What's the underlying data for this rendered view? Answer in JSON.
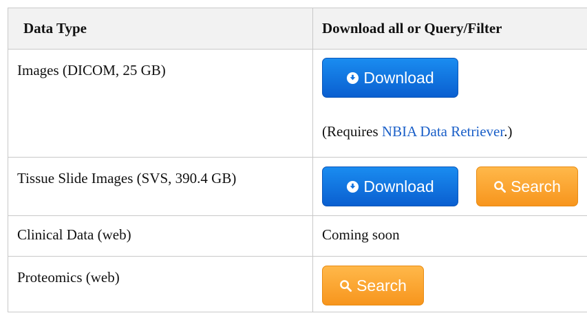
{
  "table": {
    "headers": [
      "Data Type",
      "Download all or Query/Filter"
    ],
    "rows": [
      {
        "data_type": "Images (DICOM, 25 GB)",
        "download_label": "Download",
        "requires_prefix": "(Requires ",
        "requires_link": "NBIA Data Retriever",
        "requires_suffix": ".)"
      },
      {
        "data_type": "Tissue Slide Images (SVS, 390.4 GB)",
        "download_label": "Download",
        "search_label": "Search"
      },
      {
        "data_type": "Clinical Data (web)",
        "status_text": "Coming soon"
      },
      {
        "data_type": "Proteomics (web)",
        "search_label": "Search"
      }
    ]
  },
  "colors": {
    "download_button": "#1173e0",
    "search_button": "#f9a230",
    "link": "#1a5fc8",
    "header_background": "#f2f2f2",
    "border": "#c8c8c8"
  },
  "icons": {
    "download": "circle-down-arrow-icon",
    "search": "magnifier-icon"
  }
}
